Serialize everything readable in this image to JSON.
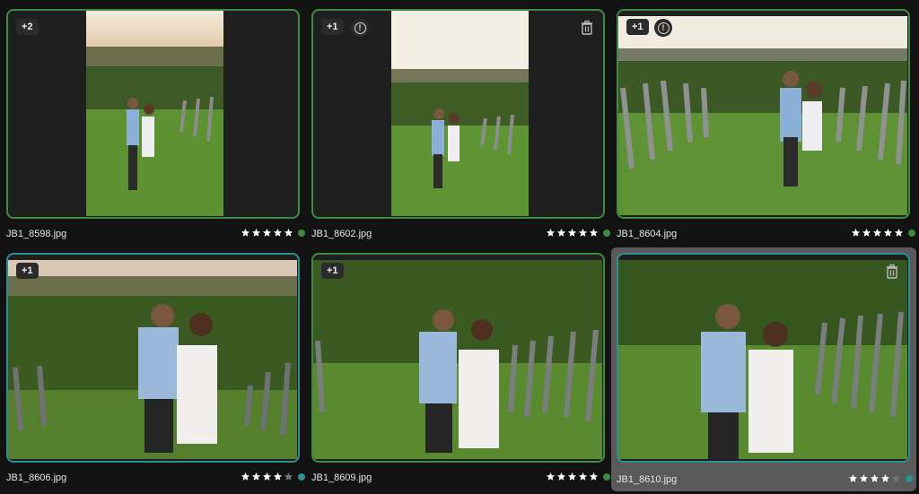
{
  "colors": {
    "green": "#3c8a46",
    "teal": "#2f8e92",
    "star_on": "#ffffff",
    "star_off": "#777777"
  },
  "photos": [
    {
      "filename": "JB1_8598.jpg",
      "badge": "+2",
      "rating": 5,
      "label": "green",
      "warning": false,
      "trash": false,
      "selected": false
    },
    {
      "filename": "JB1_8602.jpg",
      "badge": "+1",
      "rating": 5,
      "label": "green",
      "warning": true,
      "trash": true,
      "selected": false
    },
    {
      "filename": "JB1_8604.jpg",
      "badge": "+1",
      "rating": 5,
      "label": "green",
      "warning": true,
      "trash": false,
      "selected": false
    },
    {
      "filename": "JB1_8606.jpg",
      "badge": "+1",
      "rating": 4,
      "label": "teal",
      "warning": false,
      "trash": false,
      "selected": false
    },
    {
      "filename": "JB1_8609.jpg",
      "badge": "+1",
      "rating": 5,
      "label": "green",
      "warning": false,
      "trash": false,
      "selected": false
    },
    {
      "filename": "JB1_8610.jpg",
      "badge": "",
      "rating": 4,
      "label": "teal",
      "warning": false,
      "trash": true,
      "selected": true
    }
  ]
}
